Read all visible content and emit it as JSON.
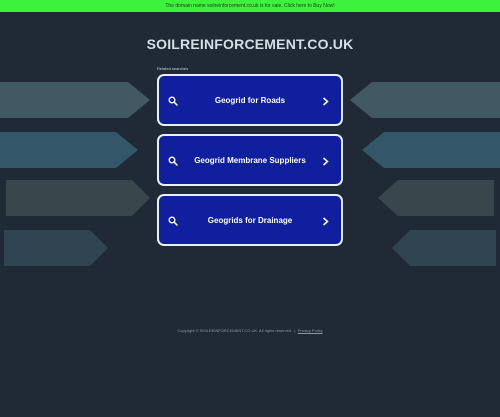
{
  "topbar": {
    "text": "The domain name soilreinforcement.co.uk is for sale. Click here to Buy Now!"
  },
  "header": {
    "domain": "SOILREINFORCEMENT.CO.UK"
  },
  "related": {
    "label": "Related searches",
    "links": [
      {
        "label": "Geogrid for Roads",
        "icon": "search-icon"
      },
      {
        "label": "Geogrid Membrane Suppliers",
        "icon": "search-icon"
      },
      {
        "label": "Geogrids for Drainage",
        "icon": "search-icon"
      }
    ]
  },
  "footer": {
    "copyright": "Copyright © SOILREINFORCEMENT.CO.UK.  All rights reserved.",
    "separator": "|",
    "privacy": "Privacy Policy"
  },
  "colors": {
    "background": "#1f2a36",
    "topbar": "#3cf23c",
    "link_bg": "#0f1f9e",
    "link_border": "#e8eef6"
  }
}
